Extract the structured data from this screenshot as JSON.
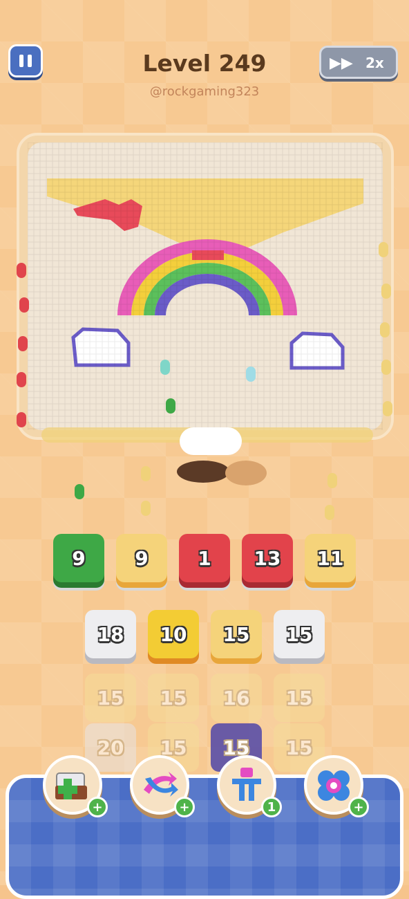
{
  "header": {
    "level_title": "Level 249",
    "handle": "@rockgaming323",
    "speed_label": "2x"
  },
  "queue_tiles": [
    {
      "value": "9",
      "color": "#3ea846"
    },
    {
      "value": "9",
      "color": "#f5d37a"
    },
    {
      "value": "1",
      "color": "#e2434b"
    },
    {
      "value": "13",
      "color": "#e2434b"
    },
    {
      "value": "11",
      "color": "#f5d37a"
    }
  ],
  "grid_tiles": [
    {
      "value": "18",
      "color": "#eeeef0"
    },
    {
      "value": "10",
      "color": "#f3cc34"
    },
    {
      "value": "15",
      "color": "#f5d37a"
    },
    {
      "value": "15",
      "color": "#eeeef0"
    },
    {
      "value": "15",
      "color": "#f6dc98"
    },
    {
      "value": "15",
      "color": "#f6dc98"
    },
    {
      "value": "16",
      "color": "#f6dc98"
    },
    {
      "value": "15",
      "color": "#f6dc98"
    },
    {
      "value": "20",
      "color": "#e8e4e2"
    },
    {
      "value": "15",
      "color": "#f6dc98"
    },
    {
      "value": "15",
      "color": "#5a4fa8"
    },
    {
      "value": "15",
      "color": "#f6dc98"
    }
  ],
  "powerups": [
    {
      "name": "add-box",
      "icon": "box-plus-icon",
      "badge": "+"
    },
    {
      "name": "shuffle",
      "icon": "shuffle-arrows-icon",
      "badge": "+"
    },
    {
      "name": "magnet",
      "icon": "magnet-claw-icon",
      "badge": "1"
    },
    {
      "name": "flower",
      "icon": "flower-icon",
      "badge": "+"
    }
  ]
}
